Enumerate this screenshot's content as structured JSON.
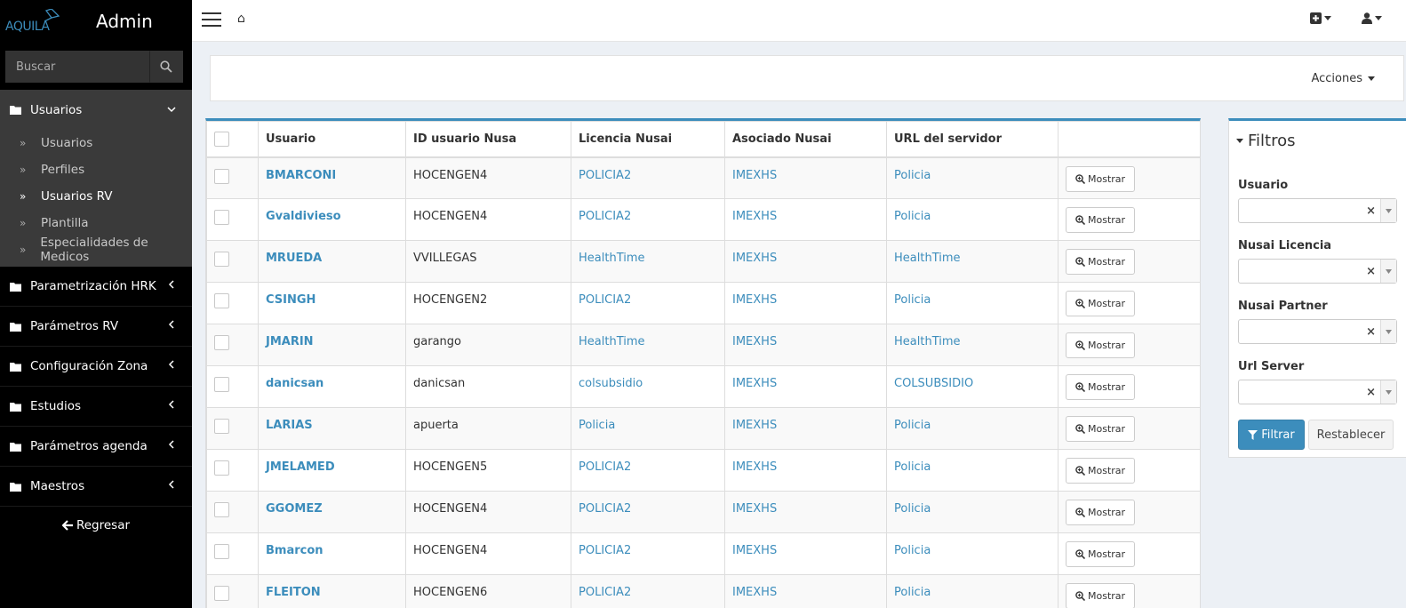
{
  "brand": {
    "logo_text": "AQUILA",
    "title": "Admin"
  },
  "search": {
    "placeholder": "Buscar"
  },
  "sidebar": {
    "active_section": "Usuarios",
    "submenu": [
      {
        "label": "Usuarios"
      },
      {
        "label": "Perfiles"
      },
      {
        "label": "Usuarios RV"
      },
      {
        "label": "Plantilla"
      },
      {
        "label": "Especialidades de Medicos"
      }
    ],
    "sections": [
      {
        "label": "Parametrización HRK"
      },
      {
        "label": "Parámetros RV"
      },
      {
        "label": "Configuración Zona"
      },
      {
        "label": "Estudios"
      },
      {
        "label": "Parámetros agenda"
      },
      {
        "label": "Maestros"
      }
    ],
    "back_label": "Regresar"
  },
  "header": {
    "home_icon": "⌂"
  },
  "toolbar": {
    "actions_label": "Acciones"
  },
  "table": {
    "columns": [
      "Usuario",
      "ID usuario Nusa",
      "Licencia Nusai",
      "Asociado Nusai",
      "URL del servidor"
    ],
    "show_label": "Mostrar",
    "rows": [
      [
        "BMARCONI",
        "HOCENGEN4",
        "POLICIA2",
        "IMEXHS",
        "Policia"
      ],
      [
        "Gvaldivieso",
        "HOCENGEN4",
        "POLICIA2",
        "IMEXHS",
        "Policia"
      ],
      [
        "MRUEDA",
        "VVILLEGAS",
        "HealthTime",
        "IMEXHS",
        "HealthTime"
      ],
      [
        "CSINGH",
        "HOCENGEN2",
        "POLICIA2",
        "IMEXHS",
        "Policia"
      ],
      [
        "JMARIN",
        "garango",
        "HealthTime",
        "IMEXHS",
        "HealthTime"
      ],
      [
        "danicsan",
        "danicsan",
        "colsubsidio",
        "IMEXHS",
        "COLSUBSIDIO"
      ],
      [
        "LARIAS",
        "apuerta",
        "Policia",
        "IMEXHS",
        "Policia"
      ],
      [
        "JMELAMED",
        "HOCENGEN5",
        "POLICIA2",
        "IMEXHS",
        "Policia"
      ],
      [
        "GGOMEZ",
        "HOCENGEN4",
        "POLICIA2",
        "IMEXHS",
        "Policia"
      ],
      [
        "Bmarcon",
        "HOCENGEN4",
        "POLICIA2",
        "IMEXHS",
        "Policia"
      ],
      [
        "FLEITON",
        "HOCENGEN6",
        "POLICIA2",
        "IMEXHS",
        "Policia"
      ]
    ]
  },
  "filters": {
    "title": "Filtros",
    "fields": [
      {
        "label": "Usuario"
      },
      {
        "label": "Nusai Licencia"
      },
      {
        "label": "Nusai Partner"
      },
      {
        "label": "Url Server"
      }
    ],
    "clear_glyph": "×",
    "filter_label": "Filtrar",
    "reset_label": "Restablecer"
  },
  "colors": {
    "accent": "#3c8dbc",
    "sidebar_bg": "#000000",
    "submenu_bg": "#3a3a3a"
  }
}
